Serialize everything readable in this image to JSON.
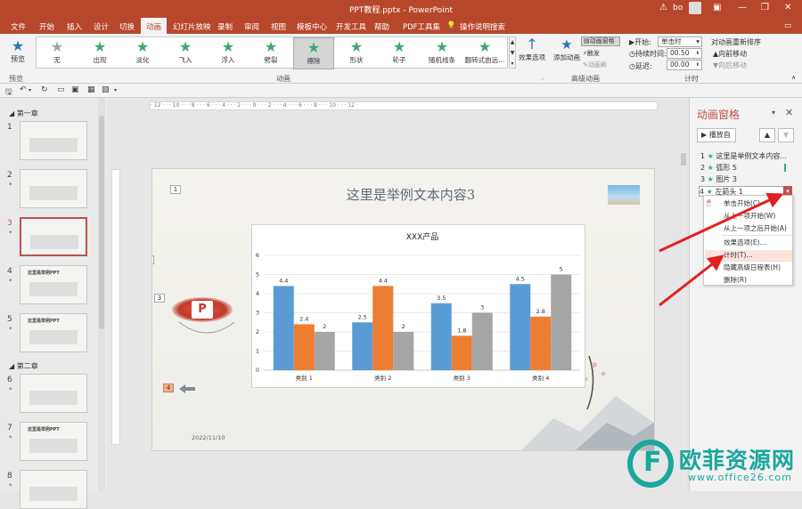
{
  "window": {
    "title": "PPT教程.pptx  -  PowerPoint",
    "user": "bo",
    "icons": {
      "warning": "warning-icon",
      "minimize": "minimize-icon",
      "restore": "restore-icon",
      "close": "close-icon"
    }
  },
  "menu": {
    "tabs": [
      "文件",
      "开始",
      "插入",
      "设计",
      "切换",
      "动画",
      "幻灯片放映",
      "录制",
      "审阅",
      "视图",
      "模板中心",
      "开发工具",
      "帮助",
      "PDF工具集",
      "操作说明搜索"
    ],
    "active": "动画"
  },
  "ribbon": {
    "preview_label": "预览",
    "preview_group": "预览",
    "animations_group": "动画",
    "animations": [
      {
        "name": "无",
        "style": "gray"
      },
      {
        "name": "出现",
        "style": "green"
      },
      {
        "name": "淡化",
        "style": "green"
      },
      {
        "name": "飞入",
        "style": "green"
      },
      {
        "name": "浮入",
        "style": "green"
      },
      {
        "name": "劈裂",
        "style": "green"
      },
      {
        "name": "擦除",
        "style": "green"
      },
      {
        "name": "形状",
        "style": "green"
      },
      {
        "name": "轮子",
        "style": "green"
      },
      {
        "name": "随机线条",
        "style": "green"
      },
      {
        "name": "翻转式由远...",
        "style": "green"
      }
    ],
    "selected_animation": "擦除",
    "effect_options": "效果选项",
    "advanced_group": "高级动画",
    "add_animation": "添加动画",
    "animation_pane_btn": "动画窗格",
    "trigger": "触发",
    "animation_painter": "动画刷",
    "timing_group": "计时",
    "start_label": "开始:",
    "start_value": "单击时",
    "duration_label": "持续时间:",
    "duration_value": "00.50",
    "delay_label": "延迟:",
    "delay_value": "00.00",
    "reorder_label": "对动画重新排序",
    "move_earlier": "向前移动",
    "move_later": "向后移动"
  },
  "thumbnails": {
    "sections": [
      {
        "name": "第一章",
        "slides": [
          1,
          2,
          3,
          4,
          5
        ]
      },
      {
        "name": "第二章",
        "slides": [
          6,
          7,
          8
        ]
      }
    ],
    "selected": 3,
    "thumb_titles": {
      "4": "这里是举例PPT",
      "5": "这里是举例PPT",
      "7": "这里是举例PPT"
    }
  },
  "ruler": {
    "horizontal": "· 12 · · · 10 · · · 8 · · · 6 · · · 4 · · · 2 · · · 0 · · · 2 · · · 4 · · · 6 · · · 8 · · · 10 · · · 12 ·"
  },
  "slide": {
    "title": "这里是举例文本内容3",
    "date": "2022/11/10",
    "markers": [
      "1",
      "2",
      "3",
      "4"
    ]
  },
  "chart_data": {
    "type": "bar",
    "title": "XXX产品",
    "categories": [
      "类别 1",
      "类别 2",
      "类别 3",
      "类别 4"
    ],
    "series": [
      {
        "values": [
          4.4,
          2.5,
          3.5,
          4.5
        ],
        "color": "#5b9bd5"
      },
      {
        "values": [
          2.4,
          4.4,
          1.8,
          2.8
        ],
        "color": "#ed7d31"
      },
      {
        "values": [
          2,
          2,
          3,
          5
        ],
        "color": "#a5a5a5"
      }
    ],
    "ylim": [
      0,
      6
    ],
    "yticks": [
      0,
      1,
      2,
      3,
      4,
      5,
      6
    ],
    "grid": true
  },
  "animation_pane": {
    "title": "动画窗格",
    "play_from": "播放自",
    "items": [
      {
        "num": "1",
        "label": "这里是举例文本内容..."
      },
      {
        "num": "2",
        "label": "弧形 5"
      },
      {
        "num": "3",
        "label": "图片 3"
      },
      {
        "num": "4",
        "label": "左箭头 1"
      }
    ]
  },
  "context_menu": {
    "items": [
      "单击开始(C)",
      "从上一项开始(W)",
      "从上一项之后开始(A)",
      "效果选项(E)...",
      "计时(T)...",
      "隐藏高级日程表(H)",
      "删除(R)"
    ],
    "highlighted": "计时(T)..."
  },
  "watermark": {
    "text": "欧菲资源网",
    "url": "www.office26.com"
  }
}
